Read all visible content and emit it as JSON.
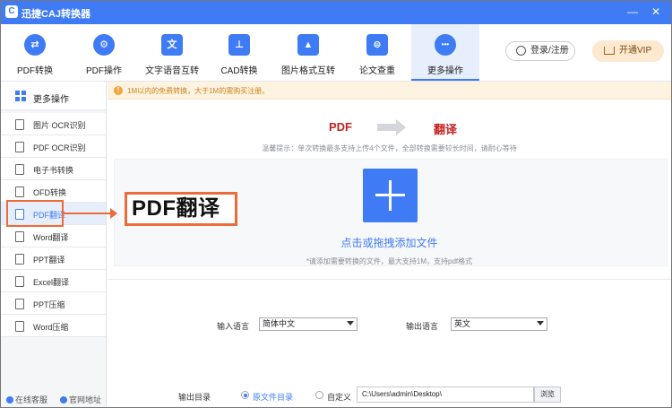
{
  "window": {
    "title": "迅捷CAJ转换器",
    "minimize": "—",
    "close": "✕",
    "logo": "C"
  },
  "toolbar": {
    "tabs": [
      {
        "label": "PDF转换",
        "icon": "pdf-convert-icon",
        "glyph": "⇄"
      },
      {
        "label": "PDF操作",
        "icon": "gear-icon",
        "glyph": "⚙"
      },
      {
        "label": "文字语音互转",
        "icon": "text-voice-icon",
        "glyph": "文"
      },
      {
        "label": "CAD转换",
        "icon": "cad-icon",
        "glyph": "⊥"
      },
      {
        "label": "图片格式互转",
        "icon": "image-icon",
        "glyph": "▲"
      },
      {
        "label": "论文查重",
        "icon": "paper-check-icon",
        "glyph": "⊜"
      },
      {
        "label": "更多操作",
        "icon": "more-icon",
        "glyph": "•••"
      }
    ],
    "active_tab": "更多操作",
    "login_label": "登录/注册",
    "vip_label": "开通VIP"
  },
  "sidebar": {
    "header": "更多操作",
    "items": [
      {
        "label": "图片 OCR识别"
      },
      {
        "label": "PDF OCR识别"
      },
      {
        "label": "电子书转换"
      },
      {
        "label": "OFD转换"
      },
      {
        "label": "PDF翻译"
      },
      {
        "label": "Word翻译"
      },
      {
        "label": "PPT翻译"
      },
      {
        "label": "Excel翻译"
      },
      {
        "label": "PPT压缩"
      },
      {
        "label": "Word压缩"
      }
    ],
    "active_item": "PDF翻译",
    "footer_service": "在线客服",
    "footer_site": "官网地址"
  },
  "notice": "1M以内的免费转换，大于1M的需购买注册。",
  "flow": {
    "from": "PDF",
    "to": "翻译"
  },
  "tip": "温馨提示：单次转换最多支持上传4个文件，全部转换需要较长时间，请耐心等待",
  "drop": {
    "text": "点击或拖拽添加文件",
    "subtext": "*请添加需要转换的文件，最大支持1M，支持pdf格式"
  },
  "callout": "PDF翻译",
  "form": {
    "input_lang_label": "输入语言",
    "input_lang_value": "简体中文",
    "output_lang_label": "输出语言",
    "output_lang_value": "英文",
    "output_dir_label": "输出目录",
    "option_original": "原文件目录",
    "option_custom": "自定义",
    "selected_option": "原文件目录",
    "path": "C:\\Users\\admin\\Desktop\\",
    "browse_label": "浏览"
  },
  "colors": {
    "accent": "#3e7bf4",
    "highlight": "#ec6b3b",
    "notice_text": "#d0811e",
    "flow": "#c62020"
  }
}
